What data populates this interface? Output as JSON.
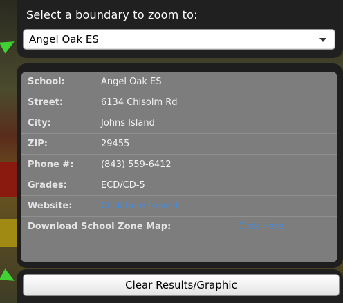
{
  "header": {
    "title": "Select a boundary to zoom to:"
  },
  "dropdown": {
    "selected": "Angel Oak ES"
  },
  "info": {
    "rows": [
      {
        "label": "School:",
        "value": "Angel Oak ES"
      },
      {
        "label": "Street:",
        "value": "6134 Chisolm Rd"
      },
      {
        "label": "City:",
        "value": "Johns Island"
      },
      {
        "label": "ZIP:",
        "value": "29455"
      },
      {
        "label": "Phone #:",
        "value": "(843) 559-6412"
      },
      {
        "label": "Grades:",
        "value": "ECD/CD-5"
      }
    ],
    "website": {
      "label": "Website:",
      "link": "Click here to visit"
    },
    "download": {
      "label": "Download School Zone Map:",
      "link": "Click Here"
    }
  },
  "actions": {
    "clear_label": "Clear Results/Graphic"
  },
  "colors": {
    "panel": "#202020",
    "info_bg": "#7d7d7d",
    "link": "#3f8ee6",
    "arrow": "#3fd233"
  }
}
